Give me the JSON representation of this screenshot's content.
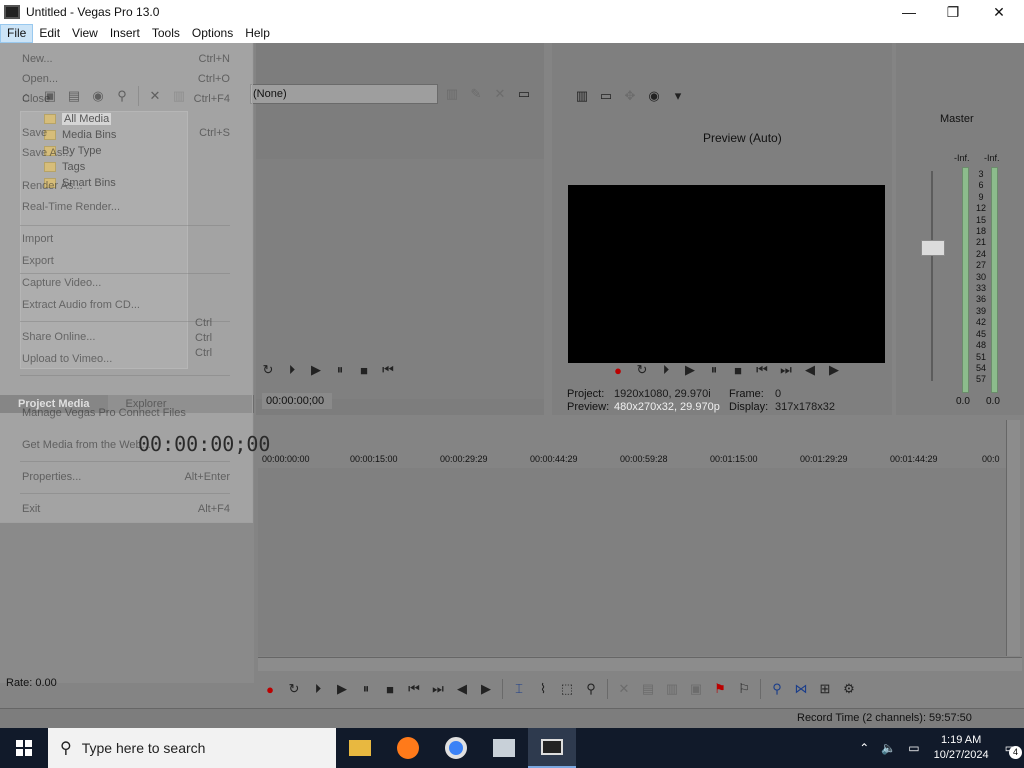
{
  "window": {
    "title": "Untitled - Vegas Pro 13.0",
    "minimize": "—",
    "maximize": "❐",
    "close": "✕"
  },
  "menu": [
    "File",
    "Edit",
    "View",
    "Insert",
    "Tools",
    "Options",
    "Help"
  ],
  "file_menu": {
    "items": [
      {
        "label": "New...",
        "shortcut": "Ctrl+N"
      },
      {
        "label": "Open...",
        "shortcut": "Ctrl+O"
      },
      {
        "label": "Close",
        "shortcut": "Ctrl+F4"
      },
      {
        "label": "Save",
        "shortcut": "Ctrl+S"
      },
      {
        "label": "Save As..."
      },
      {
        "label": "Render As..."
      },
      {
        "label": "Real-Time Render..."
      },
      {
        "label": "Import"
      },
      {
        "label": "Export"
      },
      {
        "label": "Capture Video..."
      },
      {
        "label": "Extract Audio from CD..."
      },
      {
        "label": "Share Online..."
      },
      {
        "label": "Upload to Vimeo..."
      },
      {
        "label": "Manage Vegas Pro Connect Files"
      },
      {
        "label": "Get Media from the Web..."
      },
      {
        "label": "Properties...",
        "shortcut": "Alt+Enter"
      },
      {
        "label": "Exit",
        "shortcut": "Alt+F4"
      }
    ],
    "side_shortcuts": [
      "Ctrl",
      "Ctrl",
      "Ctrl"
    ]
  },
  "explorer": {
    "tree": [
      "All Media",
      "Media Bins",
      "By Type",
      "Tags",
      "Smart Bins"
    ],
    "tabs": [
      "Project Media",
      "Explorer"
    ],
    "timecode": "00:00:00;00"
  },
  "trimmer": {
    "select_value": "(None)",
    "time": "00:00:00;00"
  },
  "preview": {
    "mode": "Preview (Auto)",
    "project_label": "Project:",
    "project_value": "1920x1080, 29.970i",
    "preview_label": "Preview:",
    "preview_value": "480x270x32, 29.970p",
    "frame_label": "Frame:",
    "frame_value": "0",
    "display_label": "Display:",
    "display_value": "317x178x32"
  },
  "master": {
    "label": "Master",
    "inf_left": "-Inf.",
    "inf_right": "-Inf.",
    "scale": [
      "3",
      "6",
      "9",
      "12",
      "15",
      "18",
      "21",
      "24",
      "27",
      "30",
      "33",
      "36",
      "39",
      "42",
      "45",
      "48",
      "51",
      "54",
      "57"
    ],
    "left_value": "0.0",
    "right_value": "0.0"
  },
  "timeline": {
    "ticks": [
      "00:00:00:00",
      "00:00:15:00",
      "00:00:29:29",
      "00:00:44:29",
      "00:00:59:28",
      "00:01:15:00",
      "00:01:29:29",
      "00:01:44:29",
      "00:0"
    ]
  },
  "status": {
    "rate": "Rate: 0.00",
    "record_time": "Record Time (2 channels): 59:57:50"
  },
  "taskbar": {
    "search_placeholder": "Type here to search",
    "time": "1:19 AM",
    "date": "10/27/2024",
    "notification_count": "4"
  }
}
